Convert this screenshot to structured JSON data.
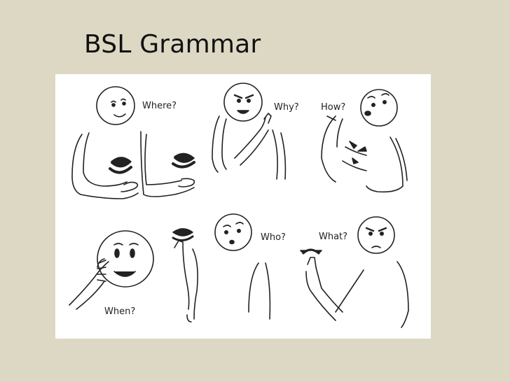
{
  "slide": {
    "title": "BSL Grammar"
  },
  "illustration": {
    "labels": {
      "where": "Where?",
      "why": "Why?",
      "how": "How?",
      "who": "Who?",
      "what": "What?",
      "when": "When?"
    }
  },
  "colors": {
    "background": "#ddd8c4",
    "panel": "#ffffff",
    "ink": "#222222"
  }
}
